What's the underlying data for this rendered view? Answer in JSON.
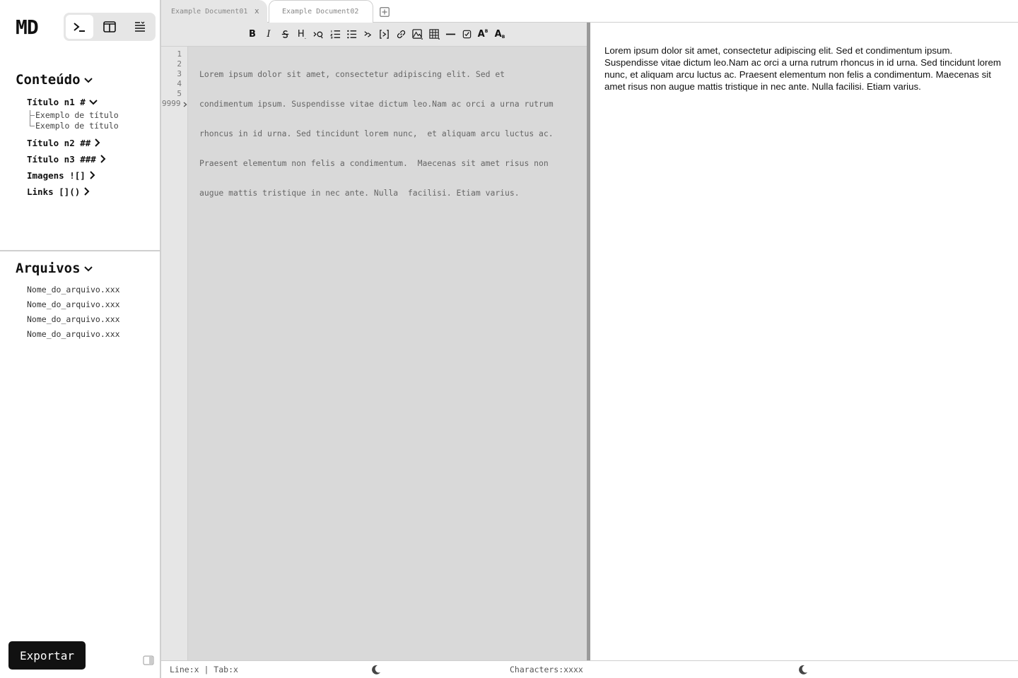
{
  "app": {
    "logo": "MD"
  },
  "view_switch": [
    {
      "name": "editor-view",
      "icon": "terminal-icon",
      "active": true
    },
    {
      "name": "split-view",
      "icon": "columns-icon",
      "active": false
    },
    {
      "name": "preview-view",
      "icon": "text-align-icon",
      "active": false
    }
  ],
  "content": {
    "title": "Conteúdo",
    "items": [
      {
        "label": "Título n1 #",
        "expanded": true,
        "children": [
          "Exemplo de título",
          "Exemplo de título"
        ]
      },
      {
        "label": "Título n2 ##",
        "expanded": false
      },
      {
        "label": "Título n3 ###",
        "expanded": false
      },
      {
        "label": "Imagens ![]",
        "expanded": false
      },
      {
        "label": "Links []()",
        "expanded": false
      }
    ]
  },
  "files": {
    "title": "Arquivos",
    "items": [
      "Nome_do_arquivo.xxx",
      "Nome_do_arquivo.xxx",
      "Nome_do_arquivo.xxx",
      "Nome_do_arquivo.xxx"
    ]
  },
  "export_label": "Exportar",
  "tabs": [
    {
      "label": "Example Document01",
      "close": "x"
    },
    {
      "label": "Example Document02"
    }
  ],
  "toolbar": {
    "bold": "B",
    "italic": "I",
    "heading": "H",
    "superscript": "A",
    "subscript": "A"
  },
  "editor": {
    "line_numbers": [
      "1",
      "2",
      "3",
      "4",
      "5",
      "9999"
    ],
    "lines": [
      "Lorem ipsum dolor sit amet, consectetur adipiscing elit. Sed et",
      "condimentum ipsum. Suspendisse vitae dictum leo.Nam ac orci a urna rutrum",
      "rhoncus in id urna. Sed tincidunt lorem nunc,  et aliquam arcu luctus ac.",
      "Praesent elementum non felis a condimentum.  Maecenas sit amet risus non",
      "augue mattis tristique in nec ante. Nulla  facilisi. Etiam varius."
    ]
  },
  "preview": {
    "text": "Lorem ipsum dolor sit amet, consectetur adipiscing elit. Sed et condimentum ipsum. Suspendisse vitae dictum leo.Nam ac orci a urna rutrum rhoncus in id urna. Sed tincidunt lorem nunc,  et aliquam arcu luctus ac. Praesent elementum non felis a condimentum. Maecenas sit amet risus non augue mattis tristique in nec ante. Nulla  facilisi. Etiam varius."
  },
  "status": {
    "line_tab": "Line:x | Tab:x",
    "characters": "Characters:xxxx"
  }
}
